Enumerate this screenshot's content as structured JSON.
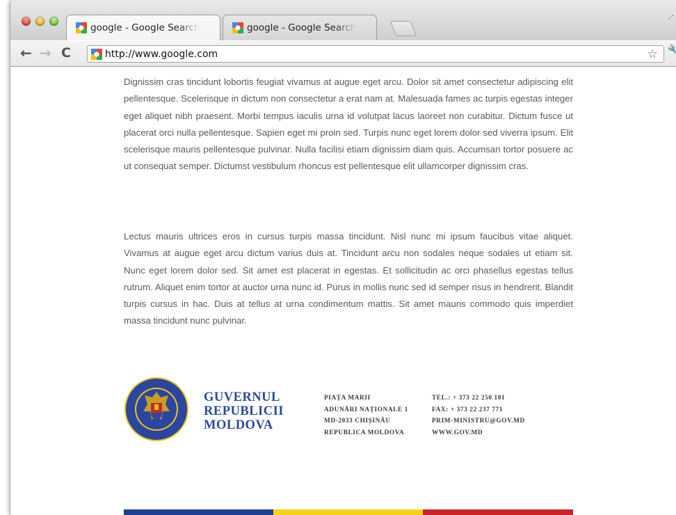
{
  "browser": {
    "tabs": [
      {
        "title": "google - Google Search \\ ×",
        "close": "×"
      },
      {
        "title": "google - Google Search \\ ×",
        "close": "×"
      }
    ],
    "url": "http://www.google.com"
  },
  "content": {
    "paragraph1": "Dignissim cras tincidunt lobortis feugiat vivamus at augue eget arcu. Dolor sit amet consectetur adipiscing elit pellentesque. Scelerisque in dictum non consectetur a erat nam at. Malesuada fames ac turpis egestas integer eget aliquet nibh praesent. Morbi tempus iaculis urna id volutpat lacus laoreet non curabitur. Dictum fusce ut placerat orci nulla pellentesque. Sapien eget mi proin sed. Turpis nunc eget lorem dolor sed viverra ipsum. Elit scelerisque mauris pellentesque pulvinar. Nulla facilisi etiam dignissim diam quis. Accumsan tortor posuere ac ut consequat semper. Dictumst vestibulum rhoncus est pellentesque elit ullamcorper dignissim cras.",
    "paragraph2": "Lectus mauris ultrices eros in cursus turpis massa tincidunt. Nisl nunc mi ipsum faucibus vitae aliquet. Vivamus at augue eget arcu dictum varius duis at. Tincidunt arcu non sodales neque sodales ut etiam sit. Nunc eget lorem dolor sed. Sit amet est placerat in egestas. Et sollicitudin ac orci phasellus egestas tellus rutrum. Aliquet enim tortor at auctor urna nunc id. Purus in mollis nunc sed id semper risus in hendrerit. Blandit turpis cursus in hac. Duis at tellus at urna condimentum mattis. Sit amet mauris commodo quis imperdiet massa tincidunt nunc pulvinar."
  },
  "footer": {
    "seal_text": "GUVERNUL REPUBLICII MOLDOVA",
    "name_lines": [
      "GUVERNUL",
      "REPUBLICII",
      "MOLDOVA"
    ],
    "address_lines": [
      "PIAȚA MARII",
      "ADUNĂRI NAȚIONALE 1",
      "MD-2033 CHIȘINĂU",
      "REPUBLICA MOLDOVA"
    ],
    "contact_lines": [
      "TEL.: + 373 22 250 101",
      "FAX: + 373 22 237 771",
      "PRIM-MINISTRU@GOV.MD",
      "WWW.GOV.MD"
    ]
  },
  "colors": {
    "flag_blue": "#1c3f94",
    "flag_yellow": "#f6d219",
    "flag_red": "#cc2229",
    "gov_blue": "#2a4a9a",
    "body_text": "#5a5a5a"
  },
  "icons": {
    "back": "arrow-left-icon",
    "forward": "arrow-right-icon",
    "reload": "reload-icon",
    "bookmark": "star-icon",
    "menu": "wrench-icon"
  }
}
